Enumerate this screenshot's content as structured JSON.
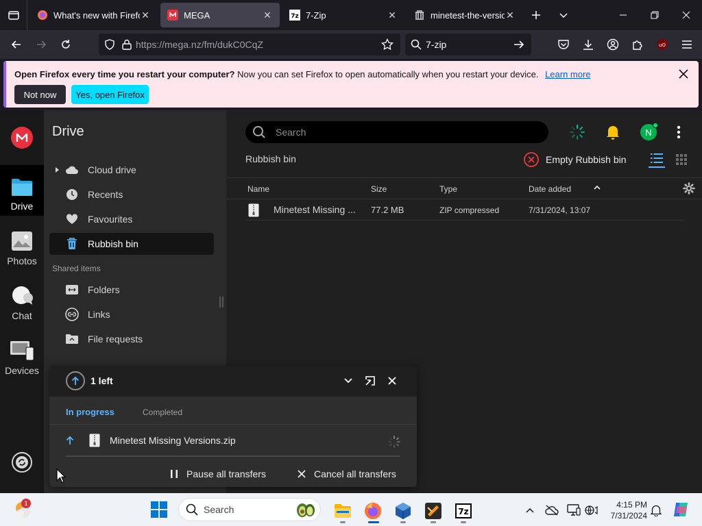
{
  "browser": {
    "tabs": [
      {
        "title": "What's new with Firefo",
        "active": false
      },
      {
        "title": "MEGA",
        "active": true
      },
      {
        "title": "7-Zip",
        "active": false
      },
      {
        "title": "minetest-the-versions",
        "active": false
      }
    ],
    "url": "https://mega.nz/fm/dukC0CqZ",
    "search_query": "7-zip"
  },
  "notification": {
    "bold_text": "Open Firefox every time you restart your computer?",
    "text": "Now you can set Firefox to open automatically when you restart your device.",
    "link": "Learn more",
    "btn_not_now": "Not now",
    "btn_yes": "Yes, open Firefox"
  },
  "rail": {
    "items": [
      {
        "label": "Drive",
        "active": true
      },
      {
        "label": "Photos",
        "active": false
      },
      {
        "label": "Chat",
        "active": false
      },
      {
        "label": "Devices",
        "active": false
      }
    ]
  },
  "sidebar": {
    "title": "Drive",
    "items": [
      {
        "label": "Cloud drive"
      },
      {
        "label": "Recents"
      },
      {
        "label": "Favourites"
      },
      {
        "label": "Rubbish bin",
        "active": true
      }
    ],
    "shared_title": "Shared items",
    "shared": [
      {
        "label": "Folders"
      },
      {
        "label": "Links"
      },
      {
        "label": "File requests"
      }
    ]
  },
  "main": {
    "search_placeholder": "Search",
    "avatar_initial": "N",
    "breadcrumb": "Rubbish bin",
    "empty_bin": "Empty Rubbish bin",
    "columns": {
      "name": "Name",
      "size": "Size",
      "type": "Type",
      "date": "Date added"
    },
    "rows": [
      {
        "name": "Minetest Missing ...",
        "size": "77.2 MB",
        "type": "ZIP compressed",
        "date": "7/31/2024, 13:07"
      }
    ]
  },
  "transfers": {
    "count": "1 left",
    "tab_in_progress": "In progress",
    "tab_completed": "Completed",
    "item_name": "Minetest Missing Versions.zip",
    "pause_all": "Pause all transfers",
    "cancel_all": "Cancel all transfers"
  },
  "taskbar": {
    "search_placeholder": "Search",
    "weather_badge": "1",
    "time": "4:15 PM",
    "date": "7/31/2024"
  },
  "colors": {
    "accent_blue": "#55b5ff",
    "mega_red": "#e9303e",
    "firefox_cyan": "#00ddff"
  }
}
